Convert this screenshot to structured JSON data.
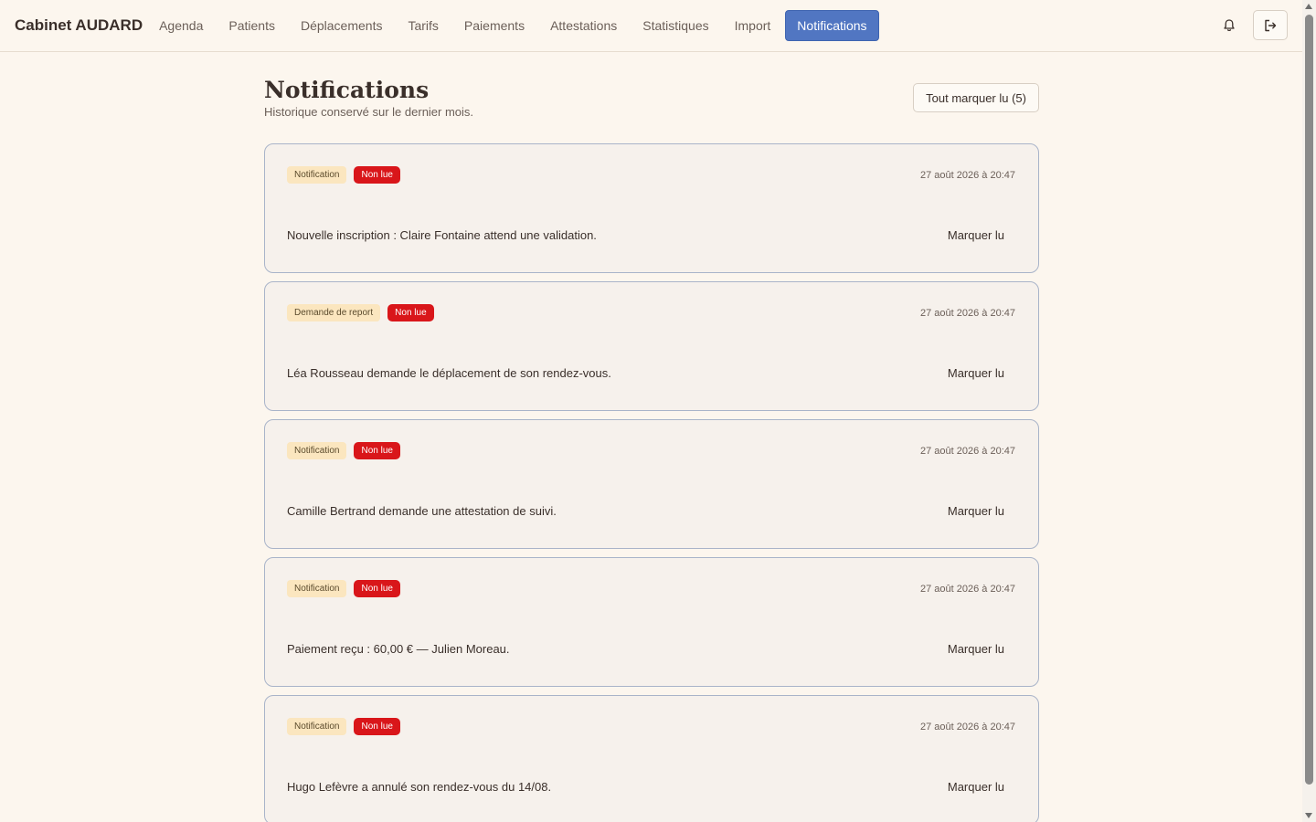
{
  "header": {
    "brand": "Cabinet AUDARD",
    "nav": [
      {
        "label": "Agenda"
      },
      {
        "label": "Patients"
      },
      {
        "label": "Déplacements"
      },
      {
        "label": "Tarifs"
      },
      {
        "label": "Paiements"
      },
      {
        "label": "Attestations"
      },
      {
        "label": "Statistiques"
      },
      {
        "label": "Import"
      },
      {
        "label": "Notifications",
        "active": true
      }
    ],
    "icons": {
      "bell": "bell-icon",
      "logout": "logout-icon"
    }
  },
  "page": {
    "title": "Notifications",
    "subtitle": "Historique conservé sur le dernier mois.",
    "mark_all_label": "Tout marquer lu (5)"
  },
  "notifications": [
    {
      "type": "Notification",
      "status": "Non lue",
      "date": "27 août 2026 à 20:47",
      "message": "Nouvelle inscription : Claire Fontaine attend une validation.",
      "action": "Marquer lu"
    },
    {
      "type": "Demande de report",
      "status": "Non lue",
      "date": "27 août 2026 à 20:47",
      "message": "Léa Rousseau demande le déplacement de son rendez-vous.",
      "action": "Marquer lu"
    },
    {
      "type": "Notification",
      "status": "Non lue",
      "date": "27 août 2026 à 20:47",
      "message": "Camille Bertrand demande une attestation de suivi.",
      "action": "Marquer lu"
    },
    {
      "type": "Notification",
      "status": "Non lue",
      "date": "27 août 2026 à 20:47",
      "message": "Paiement reçu : 60,00 € — Julien Moreau.",
      "action": "Marquer lu"
    },
    {
      "type": "Notification",
      "status": "Non lue",
      "date": "27 août 2026 à 20:47",
      "message": "Hugo Lefèvre a annulé son rendez-vous du 14/08.",
      "action": "Marquer lu"
    }
  ],
  "colors": {
    "background": "#fcf6ee",
    "accent": "#5176c2",
    "unread_badge": "#d9161a",
    "type_badge": "#fbe6bf"
  }
}
